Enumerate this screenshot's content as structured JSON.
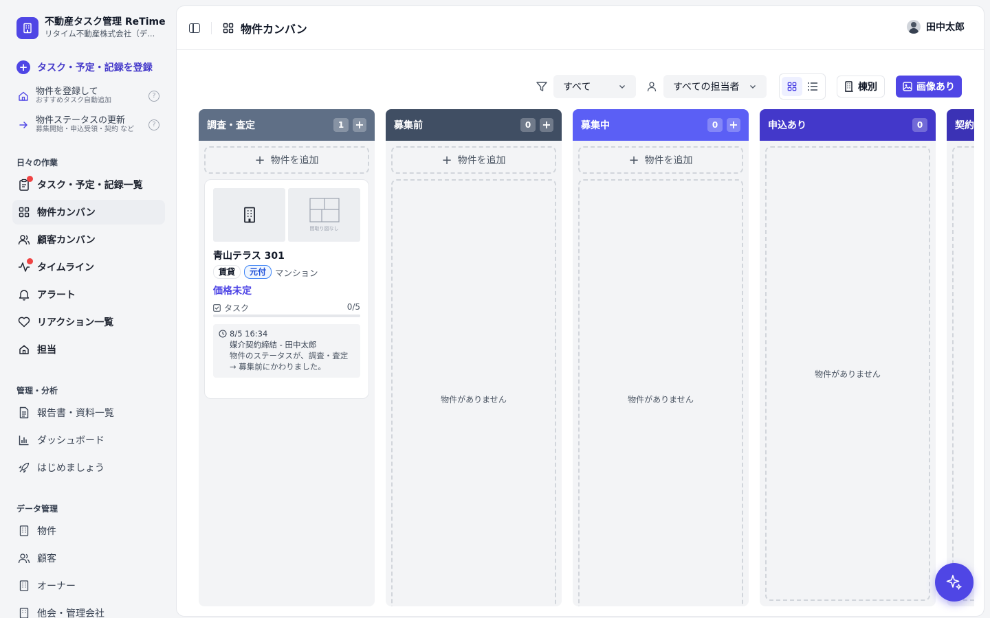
{
  "app": {
    "title": "不動産タスク管理 ReTime",
    "company": "リタイム不動産株式会社（デ..."
  },
  "sidebar": {
    "quick_register": "タスク・予定・記録を登録",
    "helpers": [
      {
        "main": "物件を登録して",
        "sub": "おすすめタスク自動追加"
      },
      {
        "main": "物件ステータスの更新",
        "sub": "募集開始・申込受領・契約 など"
      }
    ],
    "sections": {
      "daily": "日々の作業",
      "manage": "管理・分析",
      "data": "データ管理"
    },
    "daily_items": [
      {
        "label": "タスク・予定・記録一覧",
        "icon": "clipboard-icon"
      },
      {
        "label": "物件カンバン",
        "icon": "grid-icon"
      },
      {
        "label": "顧客カンバン",
        "icon": "users-icon"
      },
      {
        "label": "タイムライン",
        "icon": "activity-icon"
      },
      {
        "label": "アラート",
        "icon": "bell-icon"
      },
      {
        "label": "リアクション一覧",
        "icon": "heart-icon"
      },
      {
        "label": "担当",
        "icon": "home-icon"
      }
    ],
    "manage_items": [
      {
        "label": "報告書・資料一覧",
        "icon": "document-icon"
      },
      {
        "label": "ダッシュボード",
        "icon": "bar-chart-icon"
      },
      {
        "label": "はじめましょう",
        "icon": "rocket-icon"
      }
    ],
    "data_items": [
      {
        "label": "物件",
        "icon": "building-icon"
      },
      {
        "label": "顧客",
        "icon": "users-icon"
      },
      {
        "label": "オーナー",
        "icon": "building-icon"
      },
      {
        "label": "他会・管理会社",
        "icon": "building-icon"
      }
    ]
  },
  "header": {
    "title": "物件カンバン",
    "user_name": "田中太郎"
  },
  "toolbar": {
    "filter_value": "すべて",
    "assignee_value": "すべての担当者",
    "by_building_label": "棟別",
    "with_image_label": "画像あり"
  },
  "board": {
    "add_property_label": "物件を追加",
    "empty_label": "物件がありません",
    "columns": [
      {
        "title": "調査・査定",
        "count": "1",
        "color": "#5f6f86"
      },
      {
        "title": "募集前",
        "count": "0",
        "color": "#404e63"
      },
      {
        "title": "募集中",
        "count": "0",
        "color": "#5b5ff5"
      },
      {
        "title": "申込あり",
        "count": "0",
        "color": "#4338ca"
      },
      {
        "title": "契約",
        "count": "",
        "color": "#3b32b5"
      }
    ],
    "card": {
      "title": "青山テラス 301",
      "tags": [
        "賃貸",
        "元付"
      ],
      "type": "マンション",
      "price": "価格未定",
      "task_label": "タスク",
      "task_progress": "0/5",
      "task_done_fraction": 0,
      "floorplan_placeholder": "間取り図なし",
      "activity": {
        "time": "8/5 16:34",
        "title": "媒介契約締結 - 田中太郎",
        "message": "物件のステータスが、調査・査定 → 募集前にかわりました。"
      }
    }
  },
  "colors": {
    "accent": "#4f46e5",
    "notification_dot": "#ef4444"
  }
}
